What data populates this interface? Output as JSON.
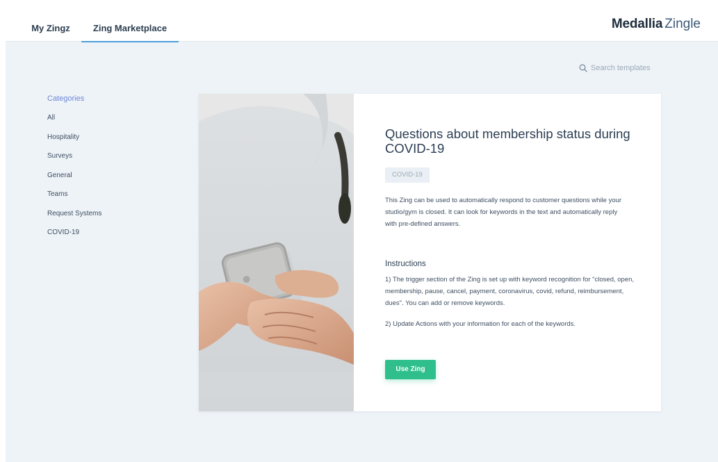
{
  "header": {
    "tabs": [
      {
        "label": "My Zingz",
        "active": false
      },
      {
        "label": "Zing Marketplace",
        "active": true
      }
    ],
    "brand": {
      "primary": "Medallia",
      "secondary": "Zingle"
    }
  },
  "search": {
    "placeholder": "Search templates",
    "icon": "search-icon"
  },
  "sidebar": {
    "heading": "Categories",
    "items": [
      {
        "label": "All"
      },
      {
        "label": "Hospitality"
      },
      {
        "label": "Surveys"
      },
      {
        "label": "General"
      },
      {
        "label": "Teams"
      },
      {
        "label": "Request Systems"
      },
      {
        "label": "COVID-19"
      }
    ]
  },
  "template": {
    "title": "Questions about membership status during COVID-19",
    "tag": "COVID-19",
    "description": "This Zing can be used to automatically respond to customer questions while your studio/gym is closed. It can look for keywords in the text and automatically reply with pre-defined answers.",
    "instructions_heading": "Instructions",
    "instructions": [
      "1) The trigger section of the Zing is set up with keyword recognition for \"closed, open, membership, pause, cancel, payment, coronavirus, covid, refund, reimbursement, dues\". You can add or remove keywords.",
      "2) Update Actions with your information for each of the keywords."
    ],
    "button_label": "Use Zing"
  },
  "colors": {
    "accent_tab": "#4a9fd8",
    "category_heading": "#6f86d6",
    "button": "#2fbf8d",
    "background": "#eef3f8"
  }
}
